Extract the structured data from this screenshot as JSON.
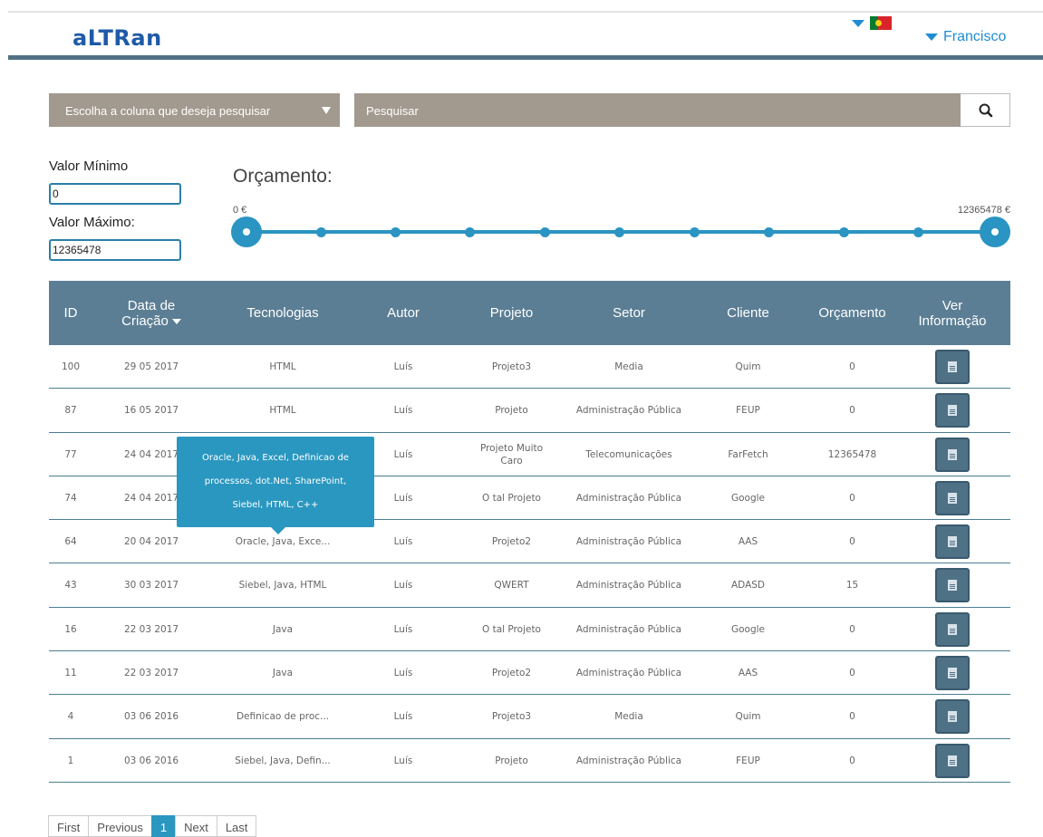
{
  "header": {
    "logo": "aLTRan",
    "language_icon": "flag-pt",
    "user_name": "Francisco"
  },
  "search": {
    "column_select_label": "Escolha a coluna que deseja pesquisar",
    "placeholder": "Pesquisar",
    "search_icon": "search-icon"
  },
  "filters": {
    "min_label": "Valor Mínimo",
    "min_value": "0",
    "max_label": "Valor Máximo:",
    "max_value": "12365478"
  },
  "budget": {
    "title": "Orçamento:",
    "min_label": "0 €",
    "max_label": "12365478 €",
    "range_min_fraction": 0,
    "range_max_fraction": 1
  },
  "table": {
    "headers": {
      "id": "ID",
      "date_line1": "Data de",
      "date_line2": "Criação",
      "tech": "Tecnologias",
      "author": "Autor",
      "project": "Projeto",
      "sector": "Setor",
      "client": "Cliente",
      "budget": "Orçamento",
      "info_line1": "Ver",
      "info_line2": "Informação"
    },
    "rows": [
      {
        "id": "100",
        "date": "29 05 2017",
        "tech": "HTML",
        "author": "Luís",
        "project": "Projeto3",
        "sector": "Media",
        "client": "Quim",
        "budget": "0"
      },
      {
        "id": "87",
        "date": "16 05 2017",
        "tech": "HTML",
        "author": "Luís",
        "project": "Projeto",
        "sector": "Administração Pública",
        "client": "FEUP",
        "budget": "0"
      },
      {
        "id": "77",
        "date": "24 04 2017",
        "tech": "",
        "author": "Luís",
        "project": "Projeto Muito Caro",
        "sector": "Telecomunicações",
        "client": "FarFetch",
        "budget": "12365478"
      },
      {
        "id": "74",
        "date": "24 04 2017",
        "tech": "",
        "author": "Luís",
        "project": "O tal Projeto",
        "sector": "Administração Pública",
        "client": "Google",
        "budget": "0"
      },
      {
        "id": "64",
        "date": "20 04 2017",
        "tech": "Oracle, Java, Exce...",
        "author": "Luís",
        "project": "Projeto2",
        "sector": "Administração Pública",
        "client": "AAS",
        "budget": "0"
      },
      {
        "id": "43",
        "date": "30 03 2017",
        "tech": "Siebel, Java, HTML",
        "author": "Luís",
        "project": "QWERT",
        "sector": "Administração Pública",
        "client": "ADASD",
        "budget": "15"
      },
      {
        "id": "16",
        "date": "22 03 2017",
        "tech": "Java",
        "author": "Luís",
        "project": "O tal Projeto",
        "sector": "Administração Pública",
        "client": "Google",
        "budget": "0"
      },
      {
        "id": "11",
        "date": "22 03 2017",
        "tech": "Java",
        "author": "Luís",
        "project": "Projeto2",
        "sector": "Administração Pública",
        "client": "AAS",
        "budget": "0"
      },
      {
        "id": "4",
        "date": "03 06 2016",
        "tech": "Definicao de proc...",
        "author": "Luís",
        "project": "Projeto3",
        "sector": "Media",
        "client": "Quim",
        "budget": "0"
      },
      {
        "id": "1",
        "date": "03 06 2016",
        "tech": "Siebel, Java, Defin...",
        "author": "Luís",
        "project": "Projeto",
        "sector": "Administração Pública",
        "client": "FEUP",
        "budget": "0"
      }
    ]
  },
  "tooltip": {
    "line1": "Oracle, Java, Excel, Definicao de",
    "line2": "processos, dot.Net, SharePoint,",
    "line3": "Siebel, HTML, C++"
  },
  "pagination": {
    "first": "First",
    "previous": "Previous",
    "current": "1",
    "next": "Next",
    "last": "Last"
  },
  "colors": {
    "accent": "#2a97c0",
    "header_bar": "#5b7e94",
    "search_bg": "#a2998f",
    "brand": "#1e5aa8"
  }
}
